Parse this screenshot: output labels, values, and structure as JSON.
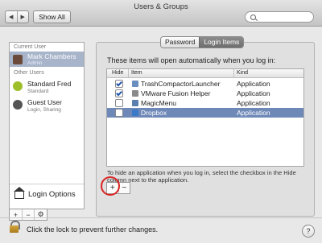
{
  "window": {
    "title": "Users & Groups"
  },
  "toolbar": {
    "back_glyph": "◀",
    "forward_glyph": "▶",
    "show_all_label": "Show All",
    "search_value": ""
  },
  "sidebar": {
    "current_user_header": "Current User",
    "current_user": {
      "name": "Mark Chambers",
      "role": "Admin",
      "avatar_color": "#6b4a3a"
    },
    "other_users_header": "Other Users",
    "other_users": [
      {
        "name": "Standard Fred",
        "role": "Standard",
        "avatar_color": "#9fbf2a"
      },
      {
        "name": "Guest User",
        "role": "Login, Sharing",
        "avatar_color": "#555555"
      }
    ],
    "login_options_label": "Login Options",
    "add_glyph": "+",
    "remove_glyph": "−",
    "gear_glyph": "⚙"
  },
  "tabs": {
    "password_label": "Password",
    "login_items_label": "Login Items",
    "selected": "Login Items"
  },
  "login_items": {
    "intro": "These items will open automatically when you log in:",
    "columns": {
      "hide": "Hide",
      "item": "Item",
      "kind": "Kind"
    },
    "rows": [
      {
        "checked": true,
        "name": "TrashCompactorLauncher",
        "kind": "Application",
        "icon_color": "#6a8fbf",
        "selected": false
      },
      {
        "checked": true,
        "name": "VMware Fusion Helper",
        "kind": "Application",
        "icon_color": "#8a8a8a",
        "selected": false
      },
      {
        "checked": false,
        "name": "MagicMenu",
        "kind": "Application",
        "icon_color": "#5d7fb0",
        "selected": false
      },
      {
        "checked": false,
        "name": "Dropbox",
        "kind": "Application",
        "icon_color": "#3a78c8",
        "selected": true
      }
    ],
    "hint": "To hide an application when you log in, select the checkbox in the Hide column next to the application.",
    "add_glyph": "+",
    "remove_glyph": "−"
  },
  "footer": {
    "lock_text": "Click the lock to prevent further changes.",
    "help_glyph": "?"
  },
  "colors": {
    "selection_blue": "#6e88b8",
    "annotation_red": "#d92424"
  }
}
